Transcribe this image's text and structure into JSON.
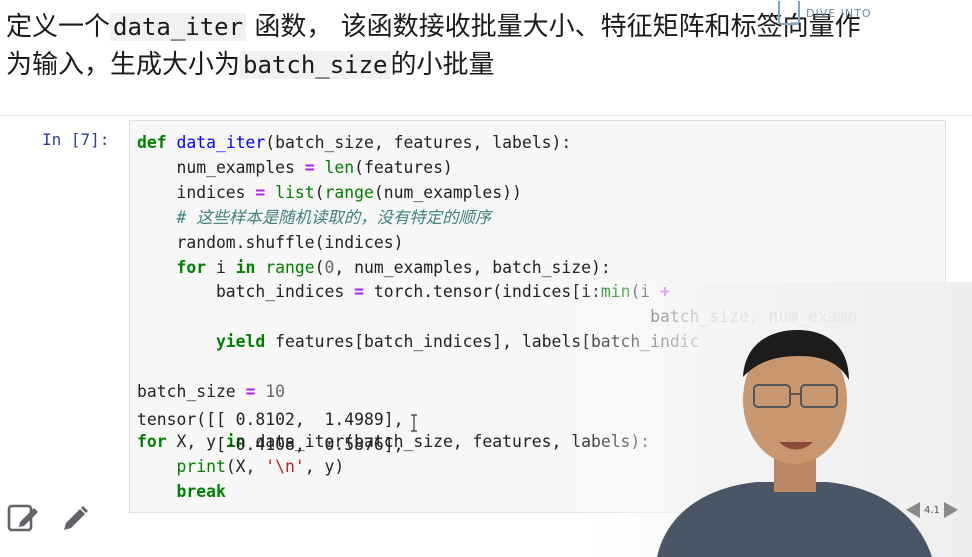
{
  "intro": {
    "line1_a": "定义一个",
    "line1_code": "data_iter",
    "line1_b": " 函数， 该函数接收批量大小、特征矩阵和标签向量作",
    "line2_a": "为输入，生成大小为",
    "line2_code": "batch_size",
    "line2_b": "的小批量"
  },
  "logo": {
    "text": "DIVE INTO"
  },
  "cell": {
    "prompt": "In [7]:"
  },
  "code": {
    "l1": {
      "kw": "def",
      "fn": "data_iter",
      "rest": "(batch_size, features, labels):"
    },
    "l2": {
      "a": "    num_examples ",
      "op": "=",
      "sp": " ",
      "bi": "len",
      "rest": "(features)"
    },
    "l3": {
      "a": "    indices ",
      "op": "=",
      "sp": " ",
      "bi1": "list",
      "p1": "(",
      "bi2": "range",
      "rest": "(num_examples))"
    },
    "l4": {
      "cm": "    # 这些样本是随机读取的，没有特定的顺序"
    },
    "l5": {
      "a": "    random.shuffle(indices)"
    },
    "l6": {
      "kw1": "    for",
      "a": " i ",
      "kw2": "in",
      "sp": " ",
      "bi": "range",
      "p": "(",
      "nm": "0",
      "rest": ", num_examples, batch_size):"
    },
    "l7": {
      "a": "        batch_indices ",
      "op1": "=",
      "b": " torch.tensor(indices[i:",
      "bi": "min",
      "c": "(i ",
      "op2": "+"
    },
    "l8": {
      "a": "                                                    batch_size, num_examp"
    },
    "l9": {
      "kw": "        yield",
      "rest": " features[batch_indices], labels[batch_indic"
    },
    "l10": {
      "a": ""
    },
    "l11": {
      "a": "batch_size ",
      "op": "=",
      "sp": " ",
      "nm": "10"
    },
    "l12": {
      "a": ""
    },
    "l13": {
      "kw1": "for",
      "a": " X, y ",
      "kw2": "in",
      "rest": " data_iter(batch_size, features, labels):"
    },
    "l14": {
      "bi": "    print",
      "a": "(X, ",
      "st": "'\\n'",
      "rest": ", y)"
    },
    "l15": {
      "kw": "    break"
    }
  },
  "output": {
    "l1": "tensor([[ 0.8102,  1.4989],",
    "l2": "        [-0.4108,  0.5876],"
  },
  "nav": {
    "page": "4.1"
  },
  "colors": {
    "prompt": "#303f9f",
    "keyword": "#008000",
    "operator": "#aa22ff",
    "comment": "#408080",
    "string": "#ba2121",
    "function_name": "#0000ff"
  },
  "icons": {
    "edit": "edit-note-icon",
    "pencil": "pencil-icon",
    "prev": "prev-arrow-icon",
    "next": "next-arrow-icon"
  }
}
